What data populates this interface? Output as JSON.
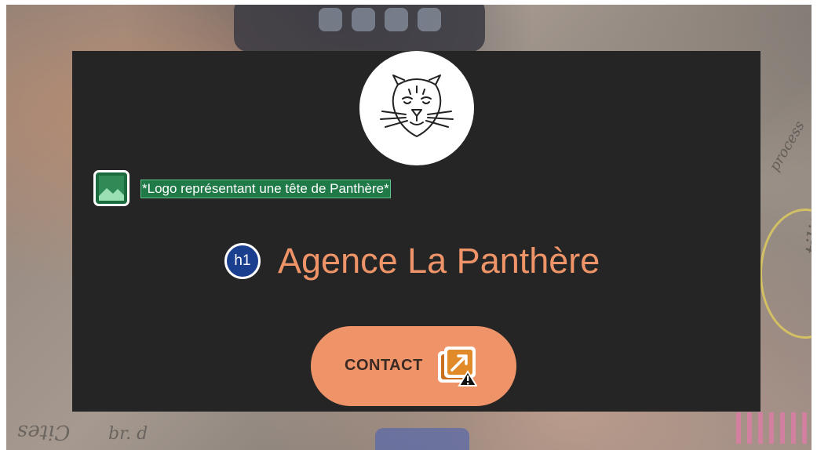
{
  "logo": {
    "icon": "panther-head-icon"
  },
  "image_alt_badge": {
    "icon": "image-icon",
    "text": "*Logo représentant une tête de Panthère*",
    "color": "#1f7a48"
  },
  "heading": {
    "badge": "h1",
    "text": "Agence La Panthère",
    "color": "#ef9468"
  },
  "contact_button": {
    "label": "CONTACT",
    "icon": "external-link-warning-icon",
    "color": "#ef9468"
  },
  "card_background": "#252525"
}
